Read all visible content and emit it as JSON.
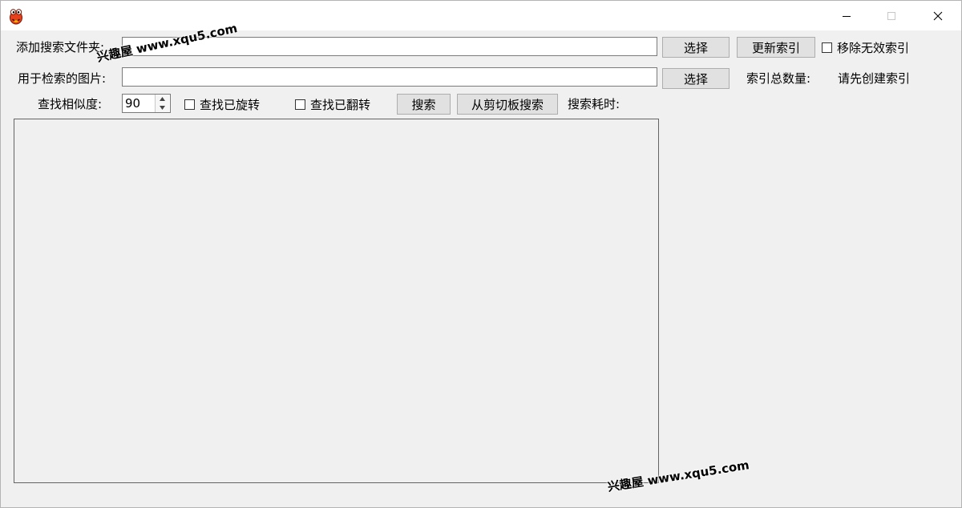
{
  "window": {
    "icon": "frog-mascot-icon"
  },
  "row1": {
    "label": "添加搜索文件夹:",
    "folder_value": "",
    "select_button": "选择",
    "update_button": "更新索引",
    "remove_invalid_label": "移除无效索引",
    "remove_invalid_checked": false
  },
  "row2": {
    "label": "用于检索的图片:",
    "image_value": "",
    "select_button": "选择",
    "index_count_label": "索引总数量:",
    "index_count_value": "请先创建索引"
  },
  "row3": {
    "similarity_label": "查找相似度:",
    "similarity_value": "90",
    "find_rotated_label": "查找已旋转",
    "find_rotated_checked": false,
    "find_flipped_label": "查找已翻转",
    "find_flipped_checked": false,
    "search_button": "搜索",
    "clipboard_search_button": "从剪切板搜索",
    "time_label": "搜索耗时:"
  },
  "watermark": {
    "text": "兴趣屋 www.xqu5.com"
  }
}
